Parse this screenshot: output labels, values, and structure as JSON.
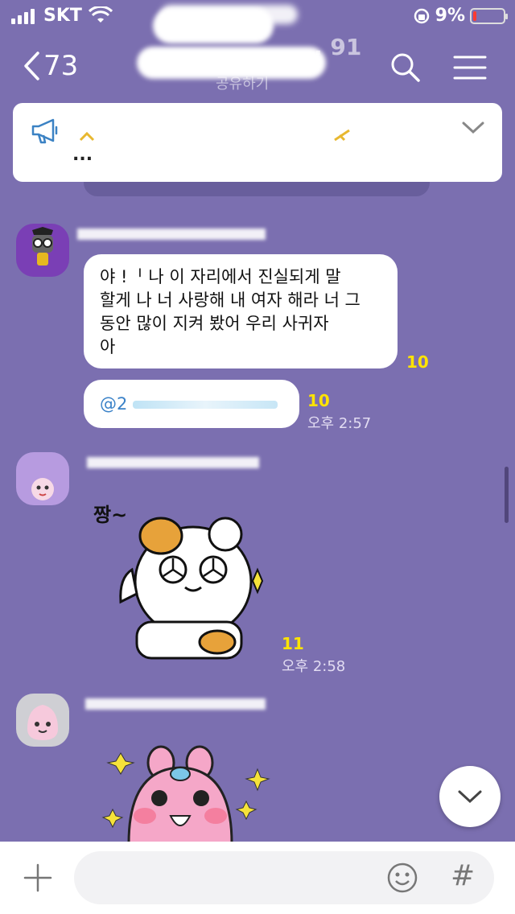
{
  "status_bar": {
    "carrier": "SKT",
    "battery_text": "9%",
    "battery_level": 0.09
  },
  "header": {
    "back_count": "73",
    "title_suffix": ". 91",
    "subtitle": "공유하기"
  },
  "notice": {
    "ellipsis": "..."
  },
  "messages": [
    {
      "bubble_lines": [
        "야 !ᅵ        나 이 자리에서 진실되게 말",
        "할게 나 너 사랑해 내 여자 해라 너 그",
        "동안 많이 지켜 봤어 우리 사귀자",
        "아"
      ],
      "unread": "10"
    },
    {
      "mention_prefix": "@2",
      "unread": "10",
      "time": "오후 2:57"
    },
    {
      "sticker_text": "짱~",
      "unread": "11",
      "time": "오후 2:58"
    }
  ],
  "composer": {
    "hash_label": "#"
  },
  "icons": [
    "back-chevron-icon",
    "search-icon",
    "menu-icon",
    "megaphone-icon",
    "chevron-down-icon",
    "plus-icon",
    "emoji-icon",
    "hash-icon",
    "wifi-icon",
    "lock-rotation-icon"
  ],
  "colors": {
    "background": "#7b6fb0",
    "unread": "#ffe400",
    "battery_low": "#ff3b30"
  }
}
